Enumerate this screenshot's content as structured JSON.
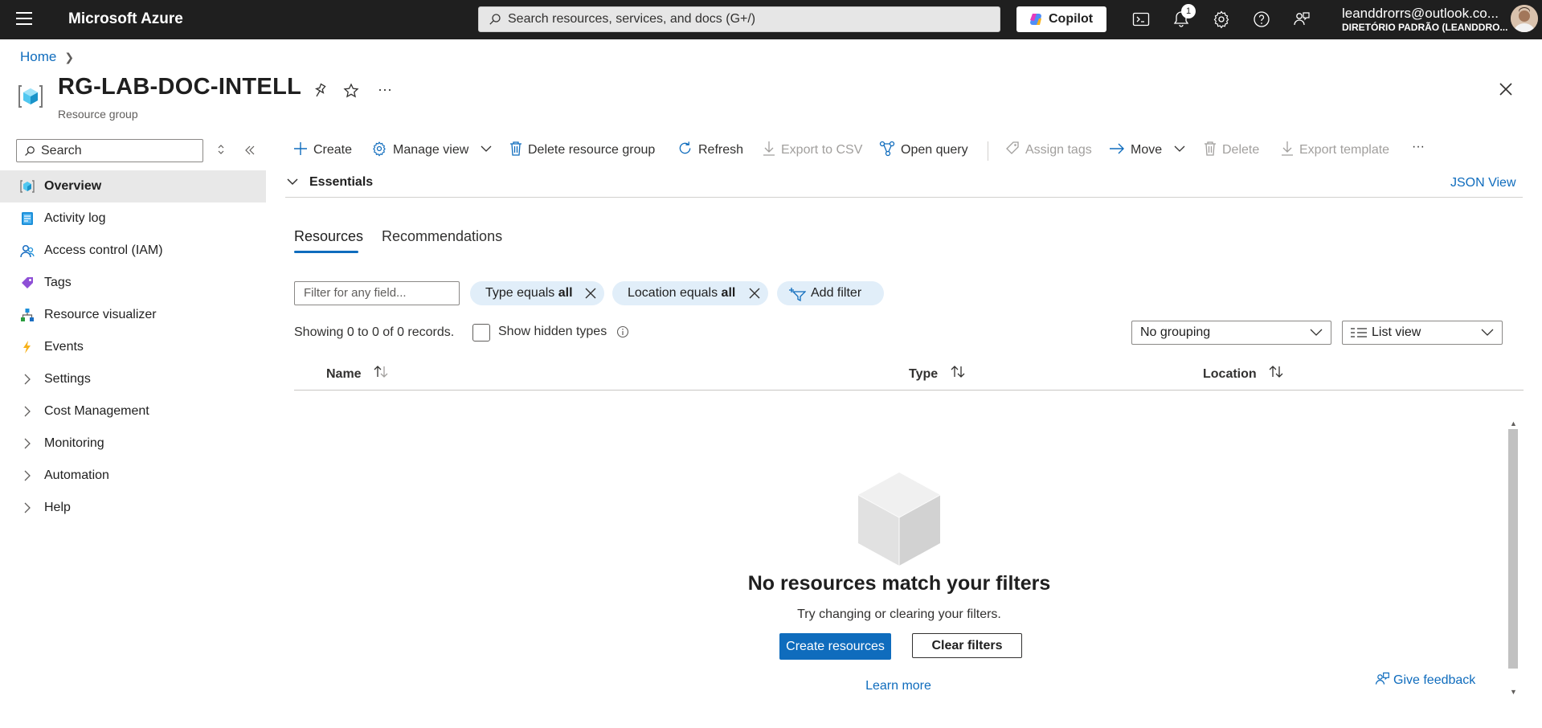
{
  "topbar": {
    "brand": "Microsoft Azure",
    "search_placeholder": "Search resources, services, and docs (G+/)",
    "copilot_label": "Copilot",
    "notification_count": "1",
    "user_email": "leanddrorrs@outlook.co...",
    "user_directory": "DIRETÓRIO PADRÃO (LEANDDRO..."
  },
  "breadcrumb": {
    "home": "Home"
  },
  "resource": {
    "title": "RG-LAB-DOC-INTELL",
    "subtitle": "Resource group",
    "more": "···"
  },
  "nav": {
    "search_placeholder": "Search",
    "items": [
      {
        "label": "Overview",
        "icon": "overview-icon"
      },
      {
        "label": "Activity log",
        "icon": "activity-log-icon"
      },
      {
        "label": "Access control (IAM)",
        "icon": "iam-icon"
      },
      {
        "label": "Tags",
        "icon": "tag-icon"
      },
      {
        "label": "Resource visualizer",
        "icon": "visualizer-icon"
      },
      {
        "label": "Events",
        "icon": "lightning-icon"
      },
      {
        "label": "Settings",
        "icon": "chevron-right-icon"
      },
      {
        "label": "Cost Management",
        "icon": "chevron-right-icon"
      },
      {
        "label": "Monitoring",
        "icon": "chevron-right-icon"
      },
      {
        "label": "Automation",
        "icon": "chevron-right-icon"
      },
      {
        "label": "Help",
        "icon": "chevron-right-icon"
      }
    ]
  },
  "toolbar": {
    "create": "Create",
    "manage_view": "Manage view",
    "delete_rg": "Delete resource group",
    "refresh": "Refresh",
    "export_csv": "Export to CSV",
    "open_query": "Open query",
    "assign_tags": "Assign tags",
    "move": "Move",
    "delete": "Delete",
    "export_template": "Export template",
    "more": "···"
  },
  "essentials": {
    "label": "Essentials",
    "json_view": "JSON View"
  },
  "tabs": {
    "resources": "Resources",
    "recommendations": "Recommendations"
  },
  "filters": {
    "input_placeholder": "Filter for any field...",
    "type_prefix": "Type equals",
    "type_value": "all",
    "location_prefix": "Location equals",
    "location_value": "all",
    "add_filter": "Add filter"
  },
  "list": {
    "records": "Showing 0 to 0 of 0 records.",
    "show_hidden": "Show hidden types",
    "grouping": "No grouping",
    "view": "List view",
    "columns": [
      "Name",
      "Type",
      "Location"
    ]
  },
  "empty": {
    "title": "No resources match your filters",
    "subtitle": "Try changing or clearing your filters.",
    "create_button": "Create resources",
    "clear_button": "Clear filters",
    "learn_more": "Learn more"
  },
  "feedback": "Give feedback",
  "colors": {
    "accent": "#0f6cbd",
    "topbar": "#1f1f1f",
    "pill": "#e1eef9"
  }
}
